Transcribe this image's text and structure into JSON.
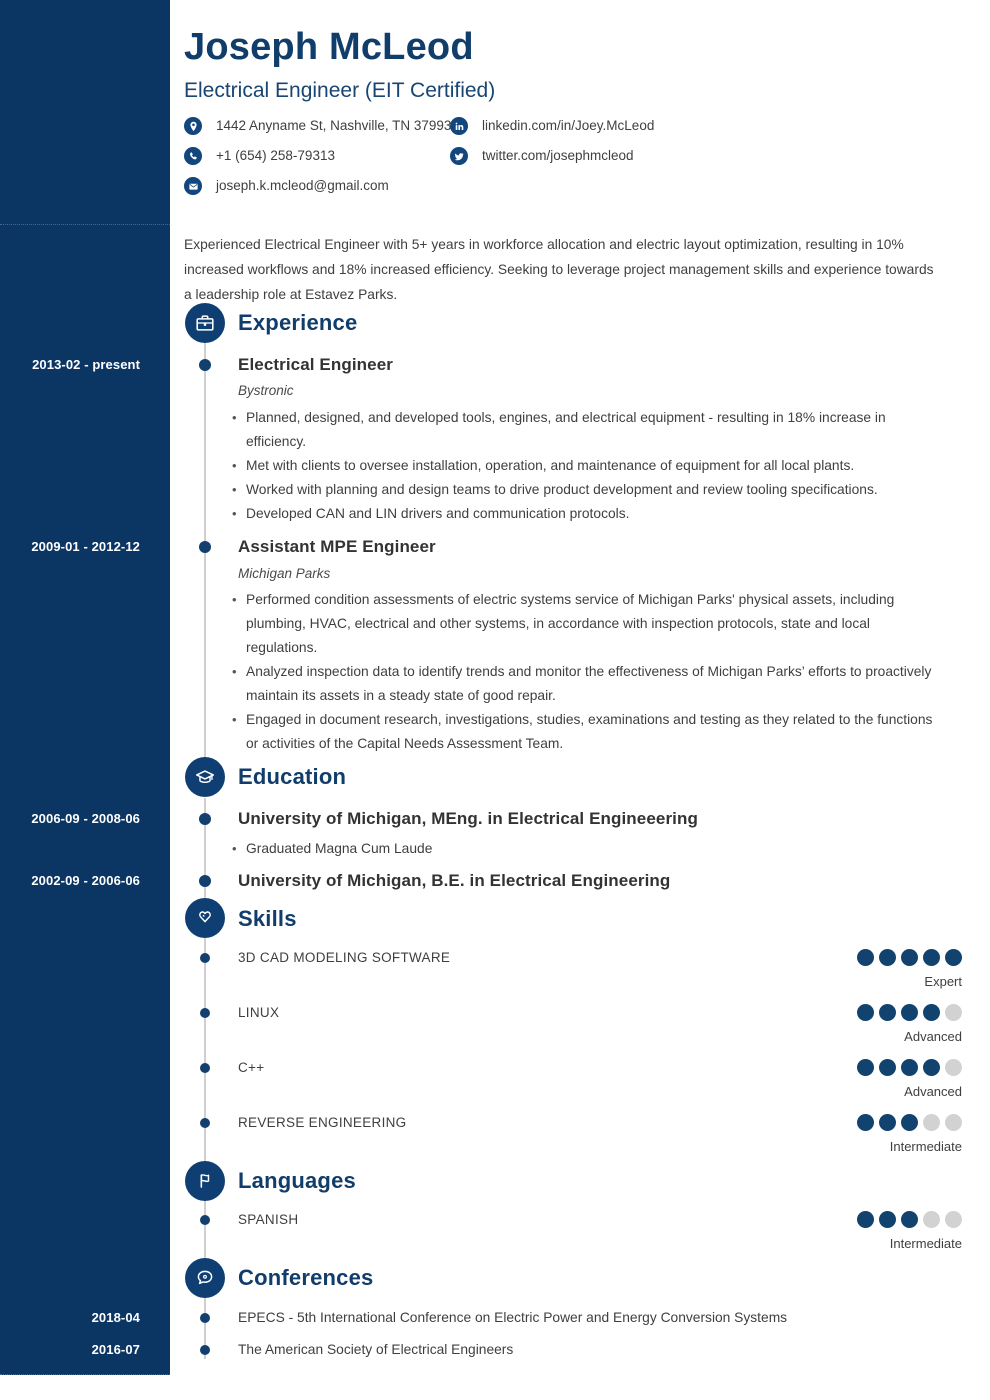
{
  "theme": {
    "sidebar_bg": "#0b3563",
    "accent": "#113d6b",
    "icon_bg": "#0f3f72",
    "dot_on": "#12436f",
    "dot_off": "#d2d2d2",
    "body_text": "#3f3f3f"
  },
  "header": {
    "name": "Joseph McLeod",
    "job_title": "Electrical Engineer (EIT Certified)",
    "contacts_left": [
      {
        "icon": "location-pin-icon",
        "text": "1442 Anyname St, Nashville, TN 37993"
      },
      {
        "icon": "phone-icon",
        "text": "+1 (654) 258-79313"
      },
      {
        "icon": "envelope-icon",
        "text": "joseph.k.mcleod@gmail.com"
      }
    ],
    "contacts_right": [
      {
        "icon": "linkedin-icon",
        "text": "linkedin.com/in/Joey.McLeod"
      },
      {
        "icon": "twitter-icon",
        "text": "twitter.com/josephmcleod"
      }
    ]
  },
  "summary": "Experienced Electrical Engineer with 5+ years in workforce allocation and electric layout optimization, resulting in 10% increased workflows and 18% increased efficiency. Seeking to leverage project management skills and experience towards a leadership role at Estavez Parks.",
  "sections": {
    "experience": {
      "title": "Experience",
      "icon": "briefcase-icon",
      "entries": [
        {
          "date": "2013-02 - present",
          "title": "Electrical Engineer",
          "subtitle": "Bystronic",
          "bullets": [
            "Planned, designed, and developed tools, engines, and electrical equipment - resulting in 18% increase in efficiency.",
            "Met with clients to oversee installation, operation, and maintenance of equipment for all local plants.",
            "Worked with planning and design teams to drive product development and review tooling specifications.",
            "Developed CAN and LIN drivers and communication protocols."
          ]
        },
        {
          "date": "2009-01 - 2012-12",
          "title": "Assistant MPE Engineer",
          "subtitle": "Michigan Parks",
          "bullets": [
            "Performed condition assessments of electric systems service of Michigan Parks' physical assets, including plumbing, HVAC, electrical and other systems, in accordance with inspection protocols, state and local regulations.",
            "Analyzed inspection data to identify trends and monitor the effectiveness of Michigan Parks’ efforts to proactively maintain its assets in a steady state of good repair.",
            "Engaged in document research, investigations, studies, examinations and testing as they related to the functions or activities of the Capital Needs Assessment Team."
          ]
        }
      ]
    },
    "education": {
      "title": "Education",
      "icon": "graduation-cap-icon",
      "entries": [
        {
          "date": "2006-09 - 2008-06",
          "title": "University of Michigan, MEng. in Electrical Engineeering",
          "bullets": [
            "Graduated Magna Cum Laude"
          ]
        },
        {
          "date": "2002-09 - 2006-06",
          "title": "University of Michigan, B.E. in Electrical Engineering",
          "bullets": []
        }
      ]
    },
    "skills": {
      "title": "Skills",
      "icon": "puzzle-heart-icon",
      "max_dots": 5,
      "entries": [
        {
          "name": "3D CAD MODELING SOFTWARE",
          "level": 5,
          "level_label": "Expert"
        },
        {
          "name": "LINUX",
          "level": 4,
          "level_label": "Advanced"
        },
        {
          "name": "C++",
          "level": 4,
          "level_label": "Advanced"
        },
        {
          "name": "REVERSE ENGINEERING",
          "level": 3,
          "level_label": "Intermediate"
        }
      ]
    },
    "languages": {
      "title": "Languages",
      "icon": "flag-icon",
      "max_dots": 5,
      "entries": [
        {
          "name": "SPANISH",
          "level": 3,
          "level_label": "Intermediate"
        }
      ]
    },
    "conferences": {
      "title": "Conferences",
      "icon": "speech-bubble-icon",
      "entries": [
        {
          "date": "2018-04",
          "text": "EPECS - 5th International Conference on Electric Power and Energy Conversion Systems"
        },
        {
          "date": "2016-07",
          "text": "The American Society of Electrical Engineers"
        }
      ]
    }
  }
}
